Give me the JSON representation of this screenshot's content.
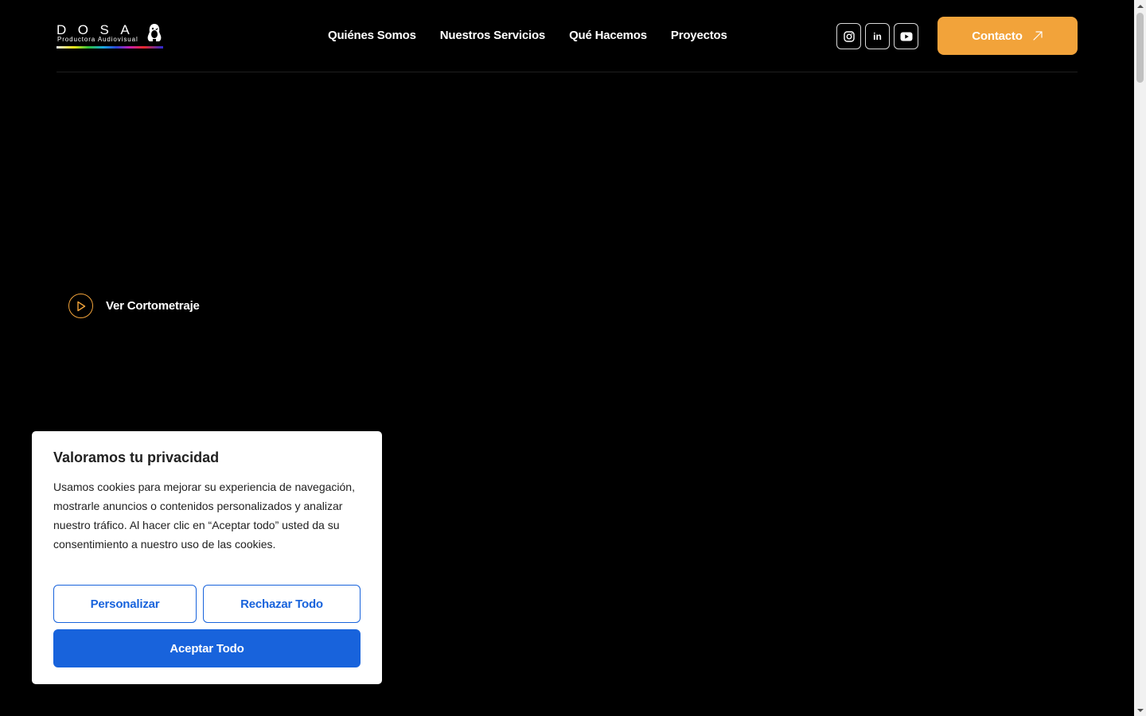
{
  "logo": {
    "word": "DOSA",
    "tagline": "Productora Audiovisual"
  },
  "nav": {
    "items": [
      {
        "label": "Quiénes Somos"
      },
      {
        "label": "Nuestros Servicios"
      },
      {
        "label": "Qué Hacemos"
      },
      {
        "label": "Proyectos"
      }
    ]
  },
  "socials": {
    "items": [
      {
        "icon": "instagram-icon"
      },
      {
        "icon": "linkedin-icon",
        "label": "in"
      },
      {
        "icon": "youtube-icon"
      }
    ]
  },
  "header": {
    "contact_label": "Contacto",
    "contact_icon": "arrow-up-right-icon"
  },
  "hero": {
    "play_label": "Ver Cortometraje",
    "play_icon": "play-icon"
  },
  "cookie": {
    "title": "Valoramos tu privacidad",
    "body": "Usamos cookies para mejorar su experiencia de navegación, mostrarle anuncios o contenidos personalizados y analizar nuestro tráfico. Al hacer clic en “Aceptar todo” usted da su consentimiento a nuestro uso de las cookies.",
    "customize_label": "Personalizar",
    "reject_label": "Rechazar Todo",
    "accept_label": "Aceptar Todo"
  },
  "colors": {
    "background": "#000000",
    "accent_orange": "#f2a33a",
    "cookie_blue": "#1863dc",
    "text_dark": "#212121"
  }
}
